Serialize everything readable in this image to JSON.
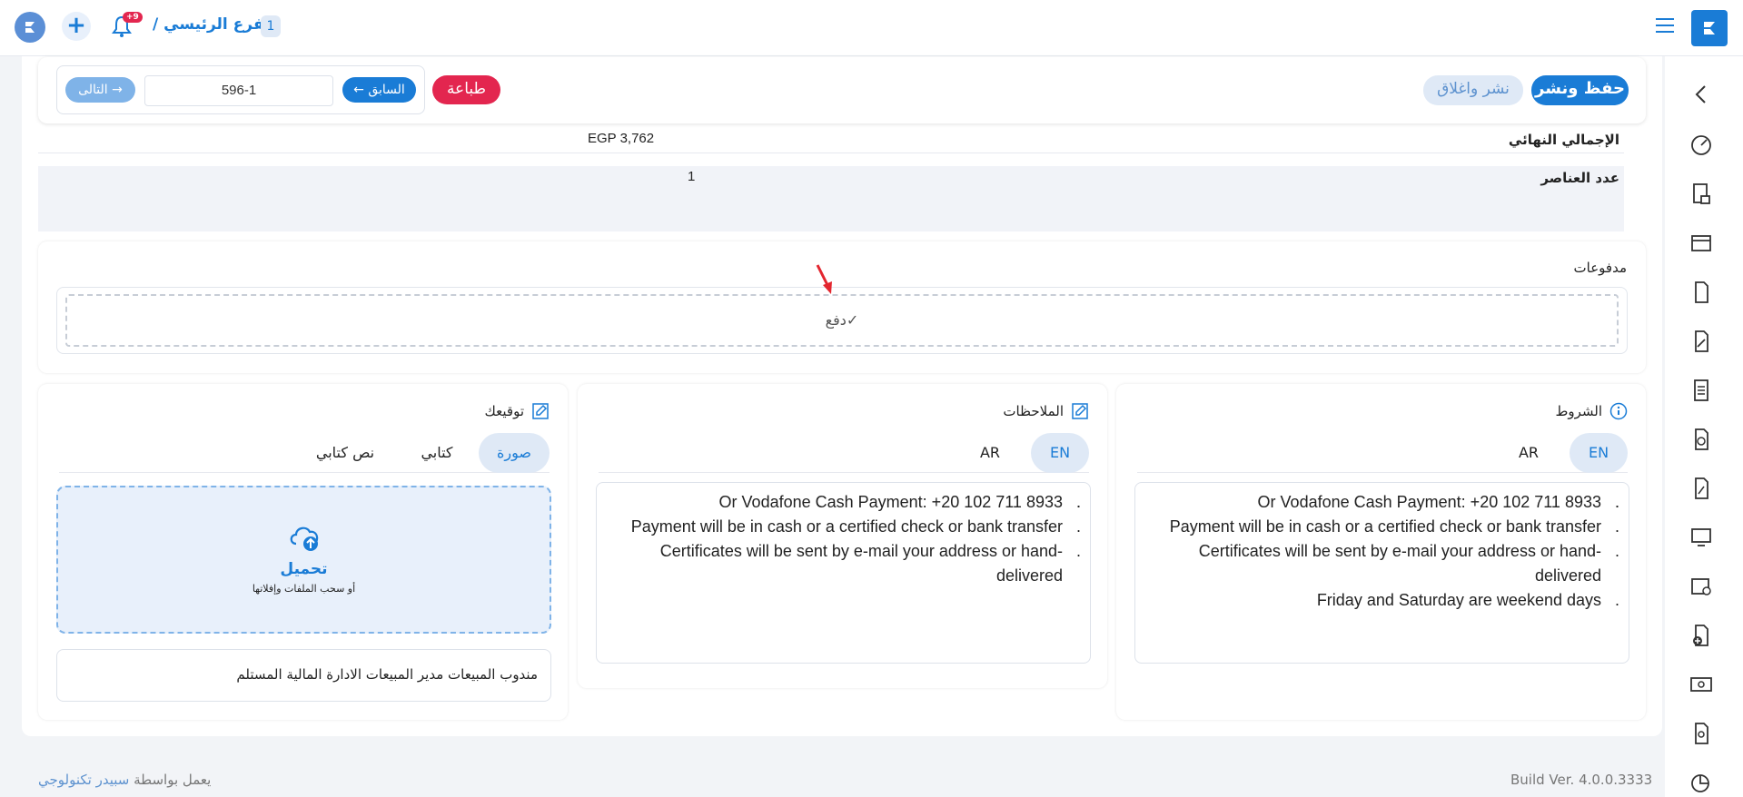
{
  "topbar": {
    "branch_name": "الفرع الرئيسي /",
    "branch_number": "1",
    "notification_badge": "+9"
  },
  "toolbar": {
    "next_label": "التالى →",
    "page_value": "596-1",
    "prev_label": "← السابق",
    "print_label": "طباعة",
    "publish_close_label": "نشر واغلاق",
    "save_publish_label": "حفظ ونشر"
  },
  "summary": {
    "total_label": "الإجمالي النهائي",
    "total_value": "EGP 3,762",
    "items_label": "عدد العناصر",
    "items_value": "1"
  },
  "payments": {
    "title": "مدفوعات",
    "pay_label": "✓دفع"
  },
  "terms": {
    "title": "الشروط",
    "tab_en": "EN",
    "tab_ar": "AR",
    "lines": [
      "",
      "Or Vodafone Cash Payment: +20 102 711 8933",
      "Payment will be in cash or a certified check or bank transfer",
      "Certificates will be sent by e-mail your address or hand-delivered",
      "Friday and Saturday are weekend days"
    ]
  },
  "notes": {
    "title": "الملاحظات",
    "tab_en": "EN",
    "tab_ar": "AR",
    "lines": [
      "",
      "Or Vodafone Cash Payment: +20 102 711 8933",
      "Payment will be in cash or a certified check or bank transfer",
      "Certificates will be sent by e-mail your address or hand-delivered"
    ]
  },
  "signature": {
    "title": "توقيعك",
    "tab_image": "صورة",
    "tab_written": "كتابي",
    "tab_text": "نص كتابي",
    "upload_title": "تحميل",
    "upload_sub": "أو سحب الملفات وإفلاتها",
    "line_text": "مندوب المبيعات مدير المبيعات الادارة المالية المستلم"
  },
  "footer": {
    "powered_by": "يعمل بواسطة",
    "company": "سبيدر تكنولوجي",
    "build": "Build Ver. 4.0.0.3333"
  },
  "colors": {
    "primary": "#1a7cd6",
    "danger": "#e3264f",
    "light_primary": "#dfe9f6"
  }
}
